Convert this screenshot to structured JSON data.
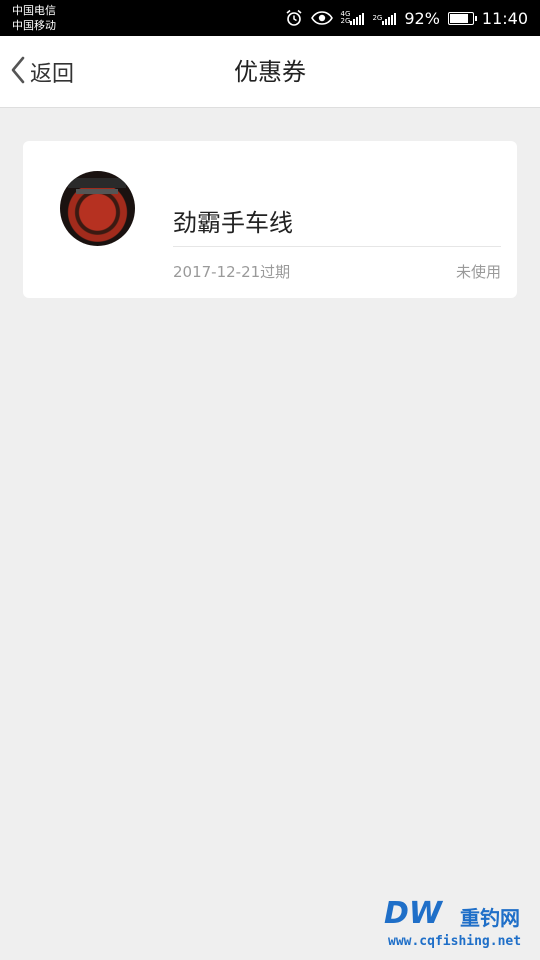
{
  "status_bar": {
    "carrier_1": "中国电信",
    "carrier_2": "中国移动",
    "net_1_top": "4G",
    "net_1_bottom": "2G",
    "net_2": "2G",
    "battery_percent": "92%",
    "battery_level": 0.92,
    "time": "11:40",
    "icons": [
      "alarm-icon",
      "eye-icon",
      "signal-icon",
      "battery-icon"
    ]
  },
  "nav": {
    "back_label": "返回",
    "title": "优惠券"
  },
  "coupon": {
    "name": "劲霸手车线",
    "expiry": "2017-12-21过期",
    "status": "未使用"
  },
  "watermark": {
    "logo": "DW",
    "name": "重钓网",
    "url": "www.cqfishing.net"
  },
  "colors": {
    "status_bar_bg": "#000000",
    "nav_bg": "#ffffff",
    "page_bg": "#efefef",
    "muted_text": "#9a9a9a",
    "watermark_blue": "#1f6fc8"
  }
}
